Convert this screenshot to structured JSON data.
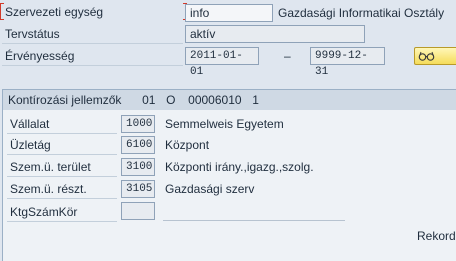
{
  "header": {
    "org_unit_label": "Szervezeti egység",
    "org_unit_value": "info",
    "org_unit_name": "Gazdasági Informatikai Osztály",
    "status_label": "Tervstátus",
    "status_value": "aktív",
    "validity_label": "Érvényesség",
    "validity_from": "2011-01-01",
    "validity_separator": "–",
    "validity_to": "9999-12-31"
  },
  "section": {
    "title": "Kontírozási jellemzők",
    "object_type": "01",
    "object_code": "O",
    "object_id": "00006010",
    "object_seq": "1"
  },
  "rows": [
    {
      "label": "Vállalat",
      "code": "1000",
      "text": "Semmelweis Egyetem"
    },
    {
      "label": "Üzletág",
      "code": "6100",
      "text": "Központ"
    },
    {
      "label": "Szem.ü. terület",
      "code": "3100",
      "text": "Központi irány.,igazg.,szolg."
    },
    {
      "label": "Szem.ü. részt.",
      "code": "3105",
      "text": "Gazdasági szerv"
    },
    {
      "label": "KtgSzámKör",
      "code": "",
      "text": ""
    }
  ],
  "footer": {
    "record_label": "Rekord"
  },
  "icons": {
    "context_button": "glasses-icon"
  }
}
